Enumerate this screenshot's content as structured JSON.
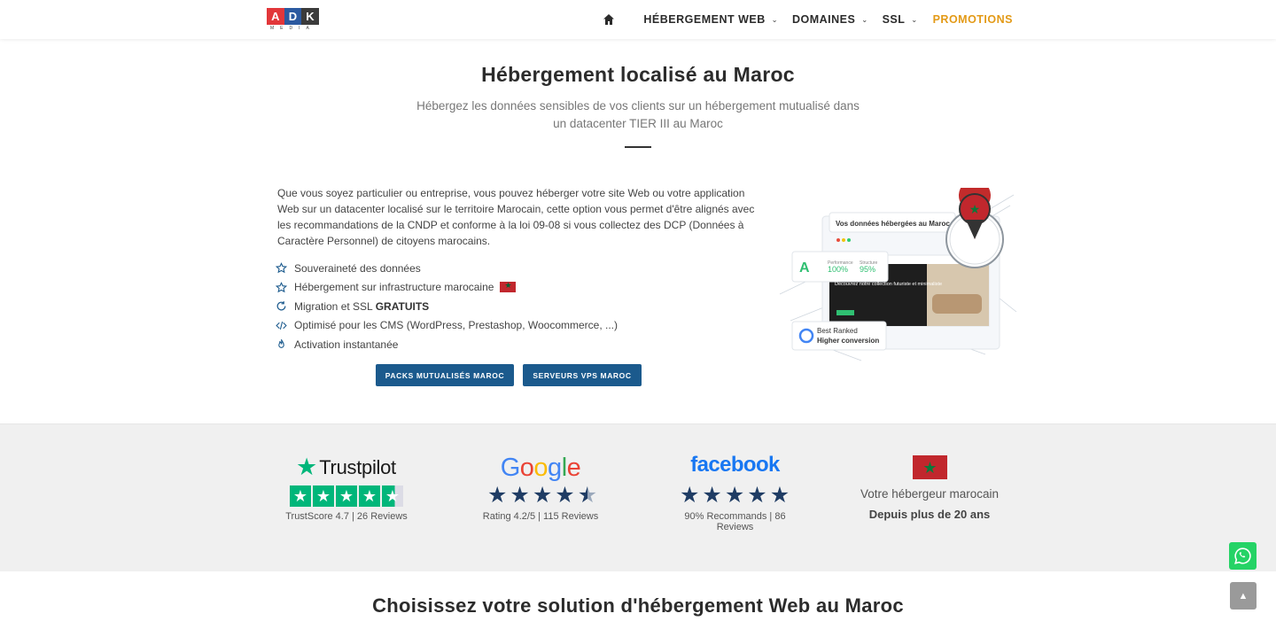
{
  "header": {
    "logo": {
      "letters": [
        "A",
        "D",
        "K"
      ],
      "letter_colors": [
        "#e2373a",
        "#2c5aa0",
        "#3b3b3b"
      ],
      "subtitle": "MEDIA"
    },
    "nav": {
      "home_icon": "home-icon",
      "items": [
        {
          "label": "HÉBERGEMENT WEB",
          "has_dropdown": true
        },
        {
          "label": "DOMAINES",
          "has_dropdown": true
        },
        {
          "label": "SSL",
          "has_dropdown": true
        },
        {
          "label": "PROMOTIONS",
          "has_dropdown": false,
          "color": "#e39a17"
        }
      ]
    }
  },
  "hero": {
    "title": "Hébergement localisé au Maroc",
    "subtitle": "Hébergez les données sensibles de vos clients sur un hébergement mutualisé dans un datacenter TIER III au Maroc",
    "paragraph": "Que vous soyez particulier ou entreprise, vous pouvez héberger votre site Web ou votre application Web sur un datacenter localisé sur le territoire Marocain, cette option vous permet d'être alignés avec les recommandations de la CNDP et conforme à la loi 09-08 si vous collectez des DCP (Données à Caractère Personnel) de citoyens marocains.",
    "features": [
      {
        "icon": "star-outline-icon",
        "text": "Souveraineté des données",
        "bold": ""
      },
      {
        "icon": "star-outline-icon",
        "text": "Hébergement sur infrastructure marocaine",
        "bold": "",
        "flag": true
      },
      {
        "icon": "refresh-icon",
        "text": "Migration et SSL",
        "bold": "GRATUITS"
      },
      {
        "icon": "code-icon",
        "text": "Optimisé pour les CMS (WordPress, Prestashop, Woocommerce, ...)",
        "bold": ""
      },
      {
        "icon": "fire-icon",
        "text": "Activation instantanée",
        "bold": ""
      }
    ],
    "buttons": {
      "primary": "PACKS MUTUALISÉS MAROC",
      "secondary": "SERVEURS VPS MAROC"
    },
    "illustration": {
      "card_title": "Vos données hébergées au Maroc",
      "metric1_label": "Performance",
      "metric1_value": "100%",
      "metric2_label": "Structure",
      "metric2_value": "95%",
      "site_headline": "Découvrez notre collection futuriste et minimaliste",
      "badge_line1": "Best Ranked",
      "badge_line2": "Higher conversion"
    }
  },
  "trust": {
    "trustpilot": {
      "logo_text": "Trustpilot",
      "score": 4.7,
      "caption": "TrustScore 4.7 | 26 Reviews"
    },
    "google": {
      "logo_text": "Google",
      "rating": 4.2,
      "caption": "Rating 4.2/5 | 115 Reviews"
    },
    "facebook": {
      "logo_text": "facebook",
      "rating": 5,
      "caption": "90% Recommands | 86 Reviews"
    },
    "morocco": {
      "line1": "Votre hébergeur marocain",
      "line2": "Depuis plus de 20 ans"
    }
  },
  "section2": {
    "title": "Choisissez votre solution d'hébergement Web au Maroc"
  },
  "floating": {
    "whatsapp_icon": "whatsapp-icon",
    "scroll_top_icon": "chevron-up-icon"
  }
}
